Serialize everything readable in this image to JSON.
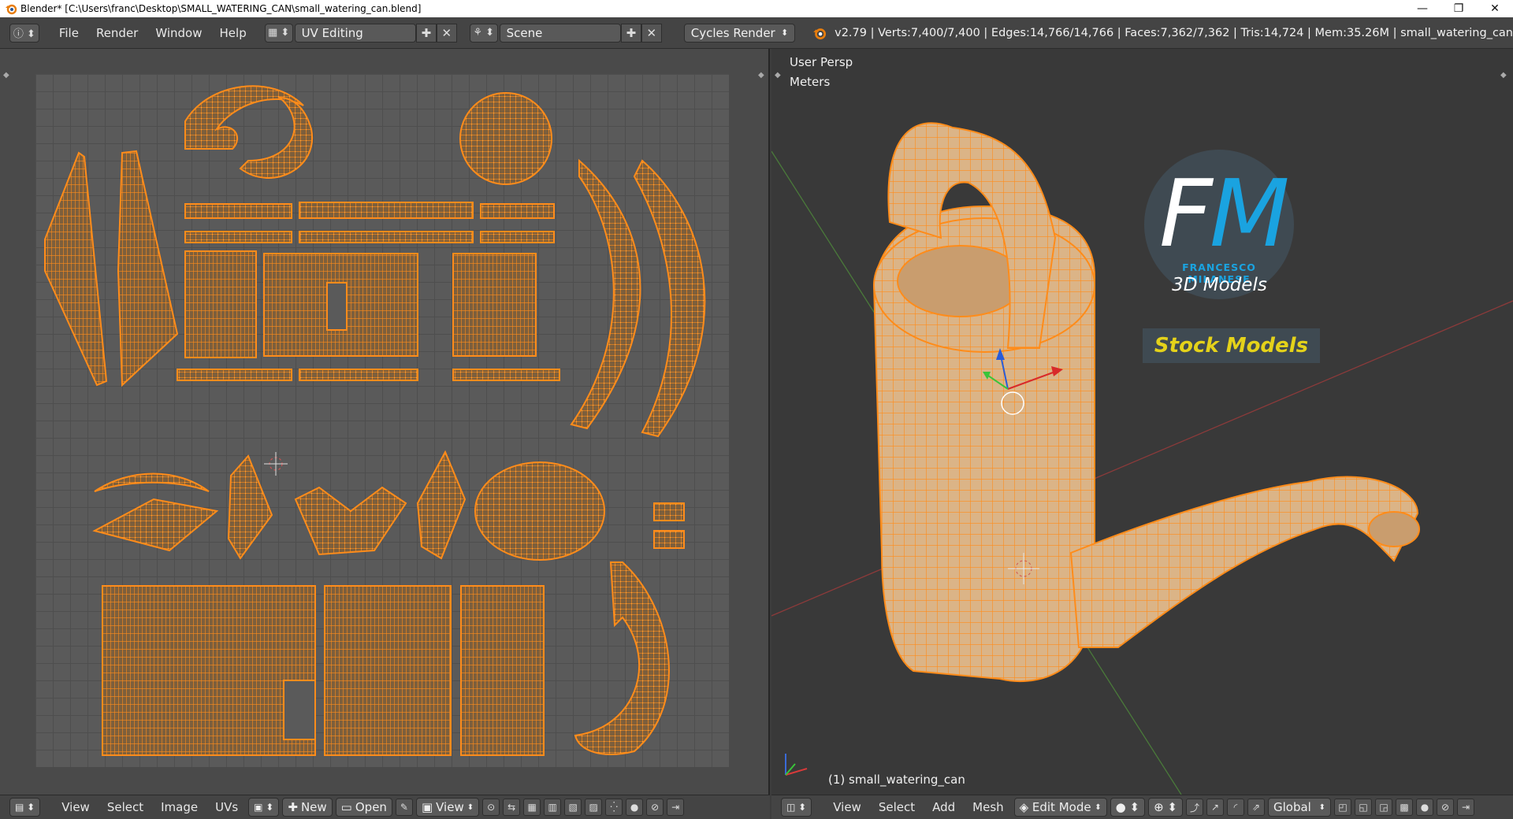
{
  "window": {
    "title": "Blender* [C:\\Users\\franc\\Desktop\\SMALL_WATERING_CAN\\small_watering_can.blend]",
    "minimize": "—",
    "maximize": "❐",
    "close": "✕"
  },
  "info_header": {
    "menus": [
      "File",
      "Render",
      "Window",
      "Help"
    ],
    "screen_layout": "UV Editing",
    "scene": "Scene",
    "render_engine": "Cycles Render",
    "stats": "v2.79 | Verts:7,400/7,400 | Edges:14,766/14,766 | Faces:7,362/7,362 | Tris:14,724 | Mem:35.26M | small_watering_can"
  },
  "uv_editor": {
    "header": {
      "menus": [
        "View",
        "Select",
        "Image",
        "UVs"
      ],
      "new_label": "New",
      "open_label": "Open",
      "view_label": "View"
    }
  },
  "viewport": {
    "view_name": "User Persp",
    "units": "Meters",
    "object_label": "(1) small_watering_can",
    "header": {
      "menus": [
        "View",
        "Select",
        "Add",
        "Mesh"
      ],
      "mode": "Edit Mode",
      "orientation": "Global"
    }
  },
  "watermark": {
    "letters_f": "F",
    "letters_m": "M",
    "name": "FRANCESCO MILANESE",
    "subtitle": "3D Models",
    "badge": "Stock Models"
  },
  "colors": {
    "accent_orange": "#ff8c1a",
    "island_fill": "#8a6a44",
    "logo_blue": "#1aa3e0",
    "logo_yellow": "#e4d21a"
  }
}
